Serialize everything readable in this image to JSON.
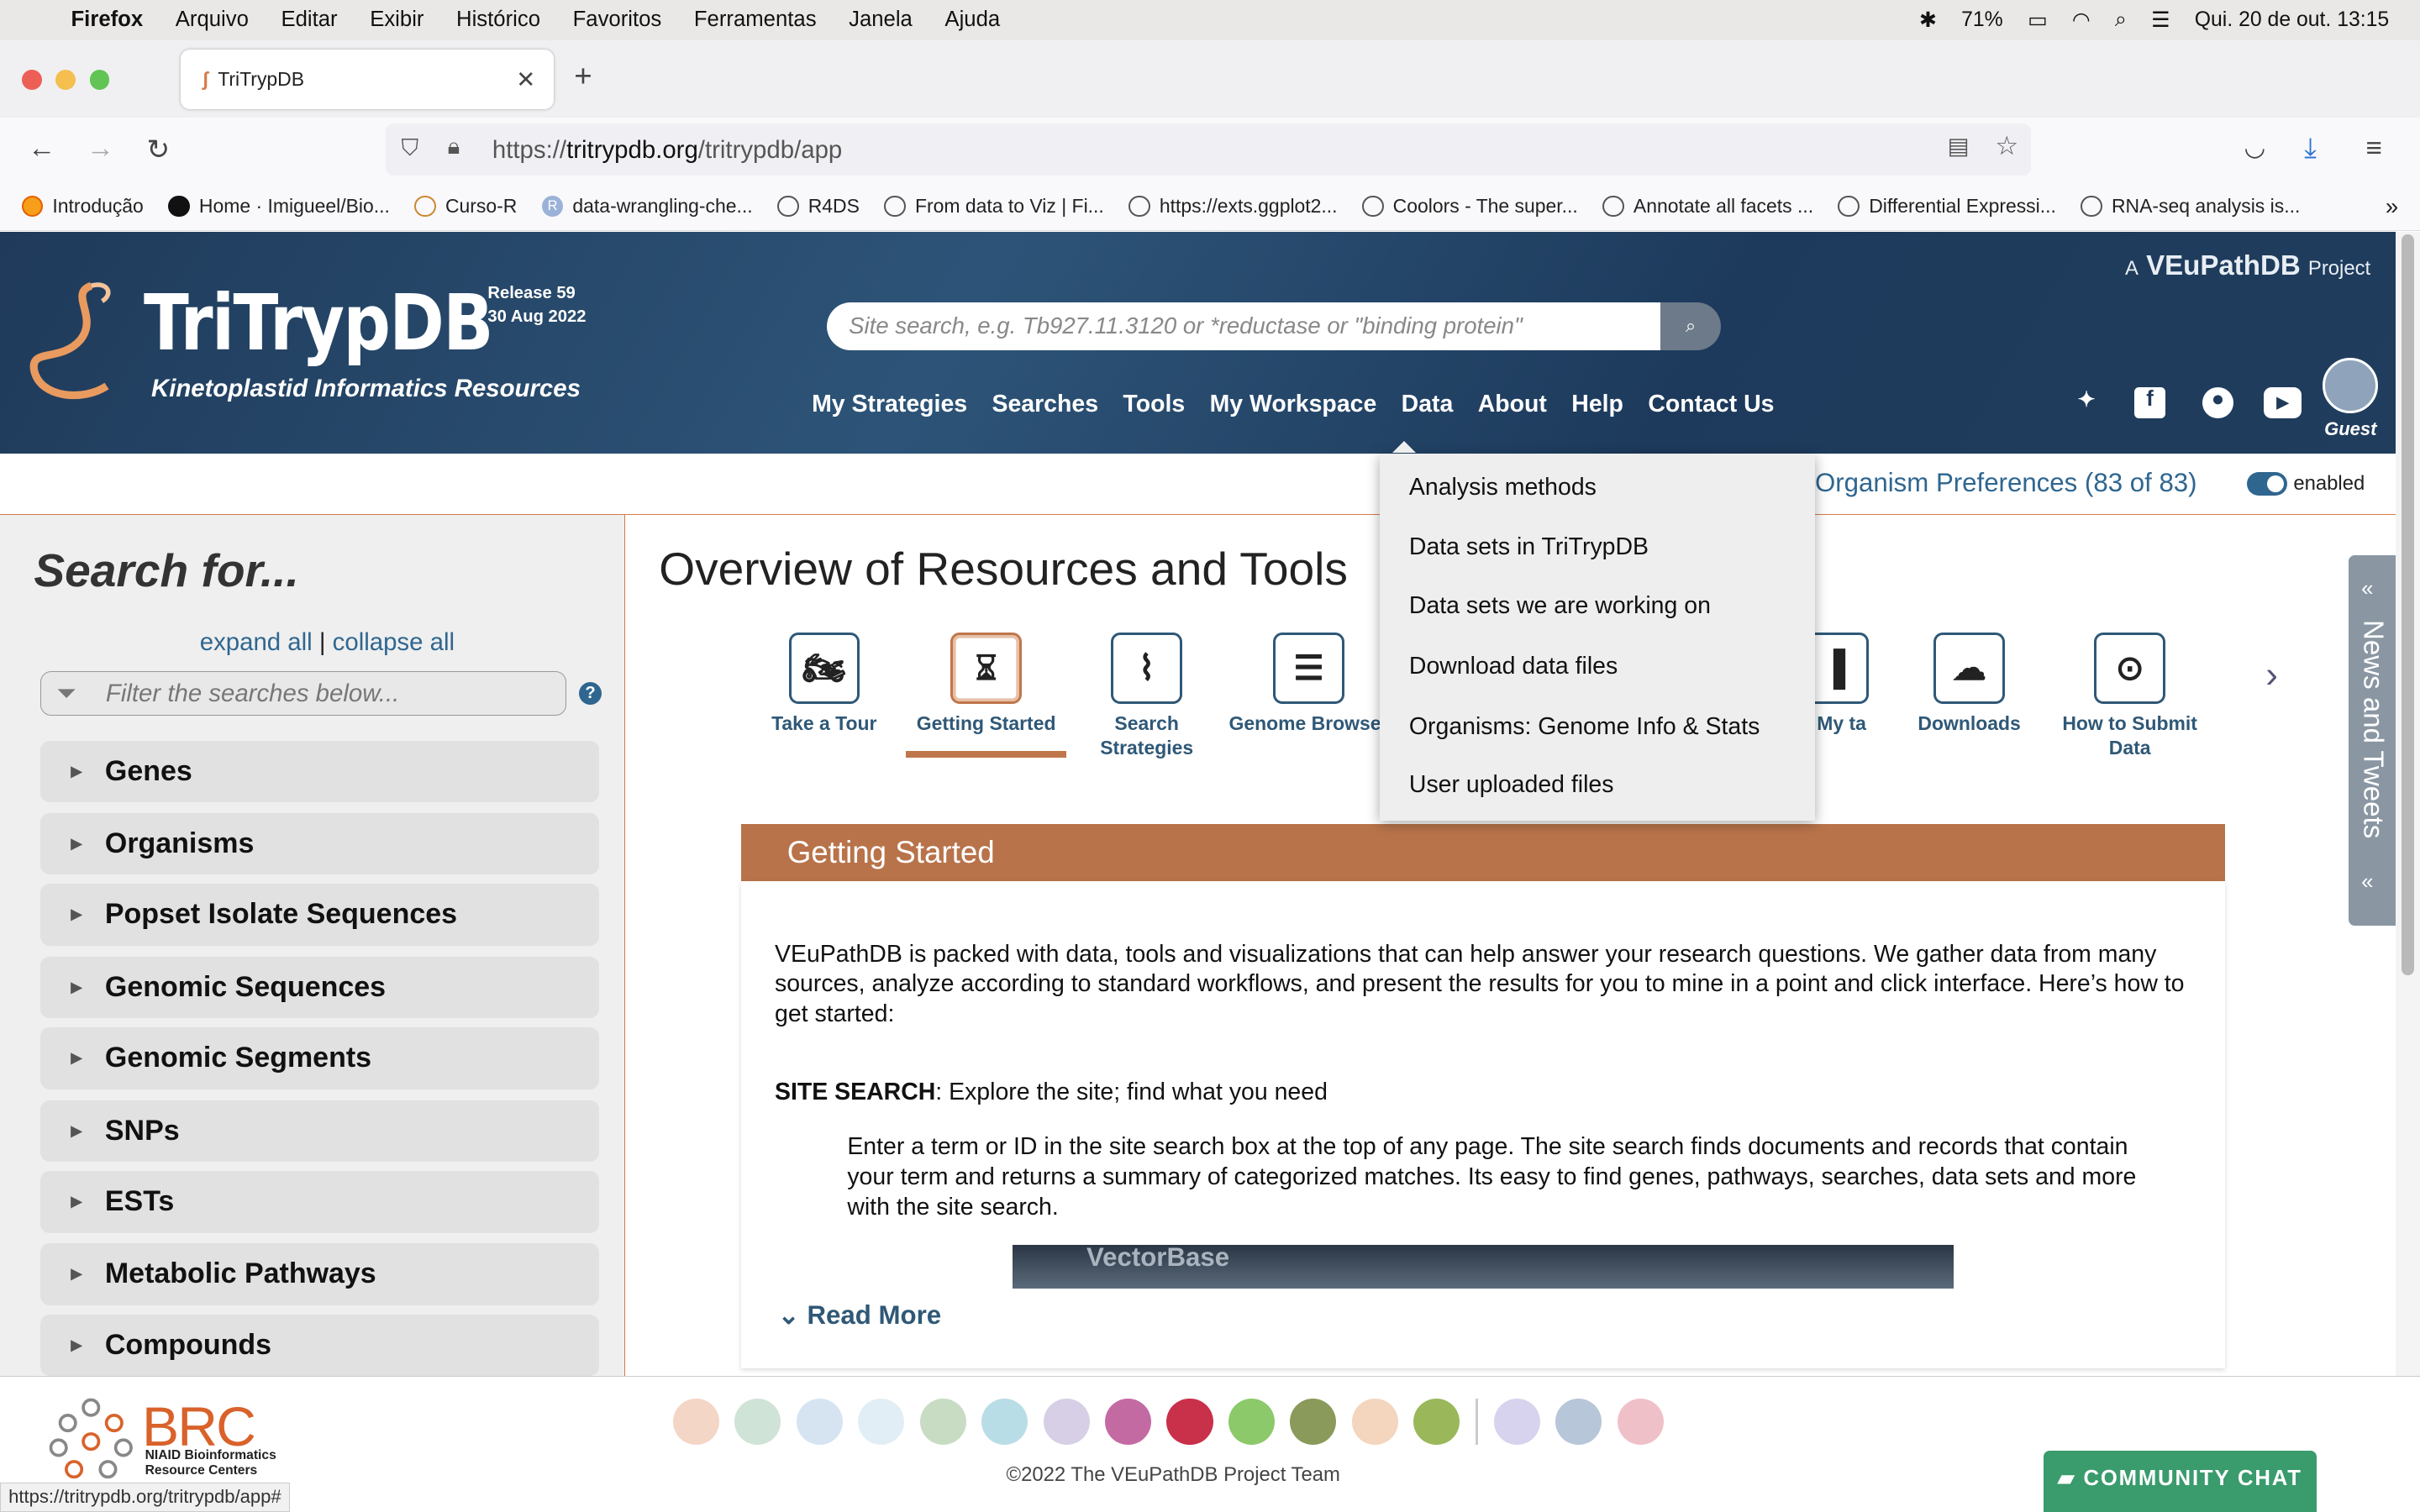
{
  "menubar": {
    "app": "Firefox",
    "items": [
      "Arquivo",
      "Editar",
      "Exibir",
      "Histórico",
      "Favoritos",
      "Ferramentas",
      "Janela",
      "Ajuda"
    ],
    "battery": "71%",
    "datetime": "Qui. 20 de out.  13:15"
  },
  "browser": {
    "tab_title": "TriTrypDB",
    "url_prefix": "https://",
    "url_domain": "tritrypdb.org",
    "url_path": "/tritrypdb/app"
  },
  "bookmarks": [
    "Introdução",
    "Home · Imigueel/Bio...",
    "Curso-R",
    "data-wrangling-che...",
    "R4DS",
    "From data to Viz | Fi...",
    "https://exts.ggplot2...",
    "Coolors - The super...",
    "Annotate all facets ...",
    "Differential Expressi...",
    "RNA-seq analysis is..."
  ],
  "header": {
    "logo_title": "TriTrypDB",
    "logo_subtitle": "Kinetoplastid Informatics Resources",
    "release_line1": "Release 59",
    "release_line2": "30 Aug 2022",
    "project_prefix": "A",
    "project_name": "VEuPathDB",
    "project_suffix": "Project",
    "search_placeholder": "Site search, e.g. Tb927.11.3120 or *reductase or \"binding protein\"",
    "nav": [
      "My Strategies",
      "Searches",
      "Tools",
      "My Workspace",
      "Data",
      "About",
      "Help",
      "Contact Us"
    ],
    "guest": "Guest"
  },
  "prefs": {
    "label": "Organism Preferences (83 of 83)",
    "toggle_label": "enabled"
  },
  "sidebar": {
    "title": "Search for...",
    "expand_all": "expand all",
    "separator": "|",
    "collapse_all": "collapse all",
    "filter_placeholder": "Filter the searches below...",
    "categories": [
      "Genes",
      "Organisms",
      "Popset Isolate Sequences",
      "Genomic Sequences",
      "Genomic Segments",
      "SNPs",
      "ESTs",
      "Metabolic Pathways",
      "Compounds"
    ]
  },
  "overview": {
    "title": "Overview of Resources and Tools",
    "tools": [
      {
        "label": "Take a Tour",
        "icon": "motorcycle-icon"
      },
      {
        "label": "Getting Started",
        "icon": "hourglass-icon"
      },
      {
        "label": "Search Strategies",
        "icon": "strategy-icon"
      },
      {
        "label": "Genome Browser",
        "icon": "sliders-icon"
      },
      {
        "label": "e My ta",
        "icon": "chart-icon"
      },
      {
        "label": "Downloads",
        "icon": "cloud-download-icon"
      },
      {
        "label": "How to Submit Data",
        "icon": "upload-icon"
      }
    ]
  },
  "getting_started": {
    "heading": "Getting Started",
    "intro": "VEuPathDB is packed with data, tools and visualizations that can help answer your research questions. We gather data from many sources, analyze according to standard workflows, and present the results for you to mine in a point and click interface. Here’s how to get started:",
    "site_search_label": "SITE SEARCH",
    "site_search_text": ": Explore the site; find what you need",
    "site_search_detail": "Enter a term or ID in the site search box at the top of any page. The site search finds documents and records that contain your term and returns a summary of categorized matches. Its easy to find genes, pathways, searches, data sets and more with the site search.",
    "video_text": "VectorBase",
    "read_more": "Read More"
  },
  "data_menu": [
    "Analysis methods",
    "Data sets in TriTrypDB",
    "Data sets we are working on",
    "Download data files",
    "Organisms: Genome Info & Stats",
    "User uploaded files"
  ],
  "news": "News and Tweets",
  "footer": {
    "brc": "BRC",
    "brc_sub1": "NIAID Bioinformatics",
    "brc_sub2": "Resource Centers",
    "copyright": "©2022 The VEuPathDB Project Team",
    "chat": "COMMUNITY CHAT"
  },
  "status_url": "https://tritrypdb.org/tritrypdb/app#",
  "colors": {
    "accent": "#b8734a",
    "link": "#2f6690",
    "header": "#1f3a5a",
    "chat": "#3a9b6d"
  }
}
